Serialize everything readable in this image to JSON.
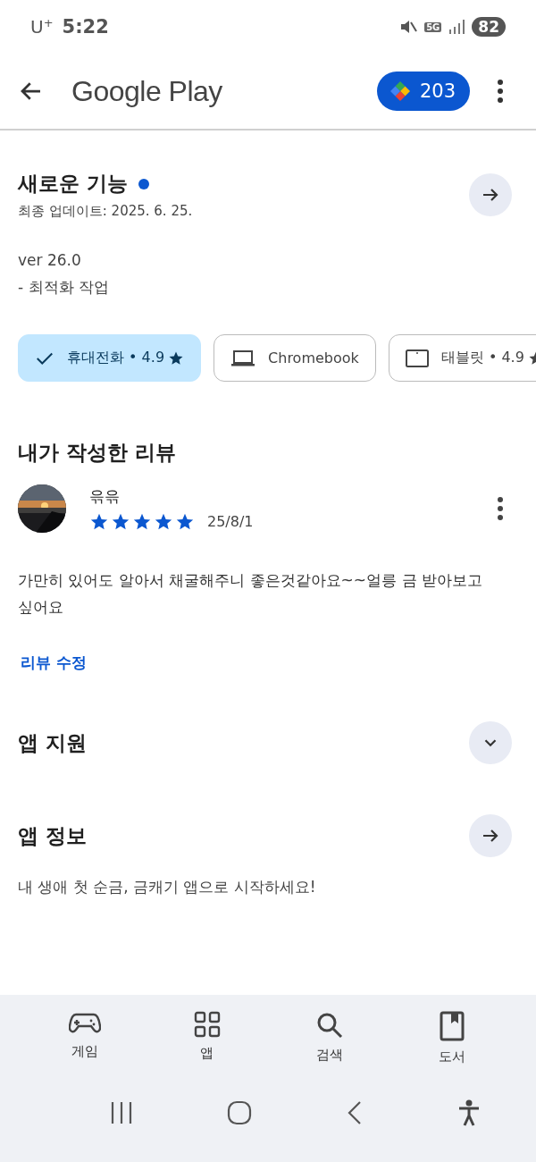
{
  "status_bar": {
    "carrier": "U",
    "carrier_mark": "+",
    "time": "5:22",
    "network": "5G",
    "battery": "82"
  },
  "app_bar": {
    "title": "Google Play",
    "points": "203"
  },
  "whats_new": {
    "title": "새로운 기능",
    "new_dot": true,
    "updated": "최종 업데이트: 2025. 6. 25.",
    "lines": [
      "ver 26.0",
      "- 최적화 작업"
    ]
  },
  "device_chips": [
    {
      "kind": "phone",
      "label": "휴대전화 • 4.9",
      "star": true,
      "selected": true
    },
    {
      "kind": "laptop",
      "label": "Chromebook",
      "star": false,
      "selected": false
    },
    {
      "kind": "tablet",
      "label": "태블릿 • 4.9",
      "star": true,
      "selected": false
    }
  ],
  "my_review": {
    "heading": "내가 작성한 리뷰",
    "author": "윾윾",
    "stars": 5,
    "date": "25/8/1",
    "text": "가만히 있어도 알아서 채굴해주니 좋은것같아요~~얼릉 금 받아보고 싶어요",
    "edit_link": "리뷰 수정"
  },
  "sections": [
    {
      "title": "앱 지원",
      "kind": "expand"
    },
    {
      "title": "앱 정보",
      "kind": "arrow",
      "description": "내 생애 첫 순금, 금캐기 앱으로 시작하세요!"
    }
  ],
  "bottom_nav": [
    {
      "kind": "games",
      "label": "게임",
      "selected": false
    },
    {
      "kind": "apps",
      "label": "앱",
      "selected": false
    },
    {
      "kind": "search",
      "label": "검색",
      "selected": false
    },
    {
      "kind": "books",
      "label": "도서",
      "selected": false
    }
  ]
}
